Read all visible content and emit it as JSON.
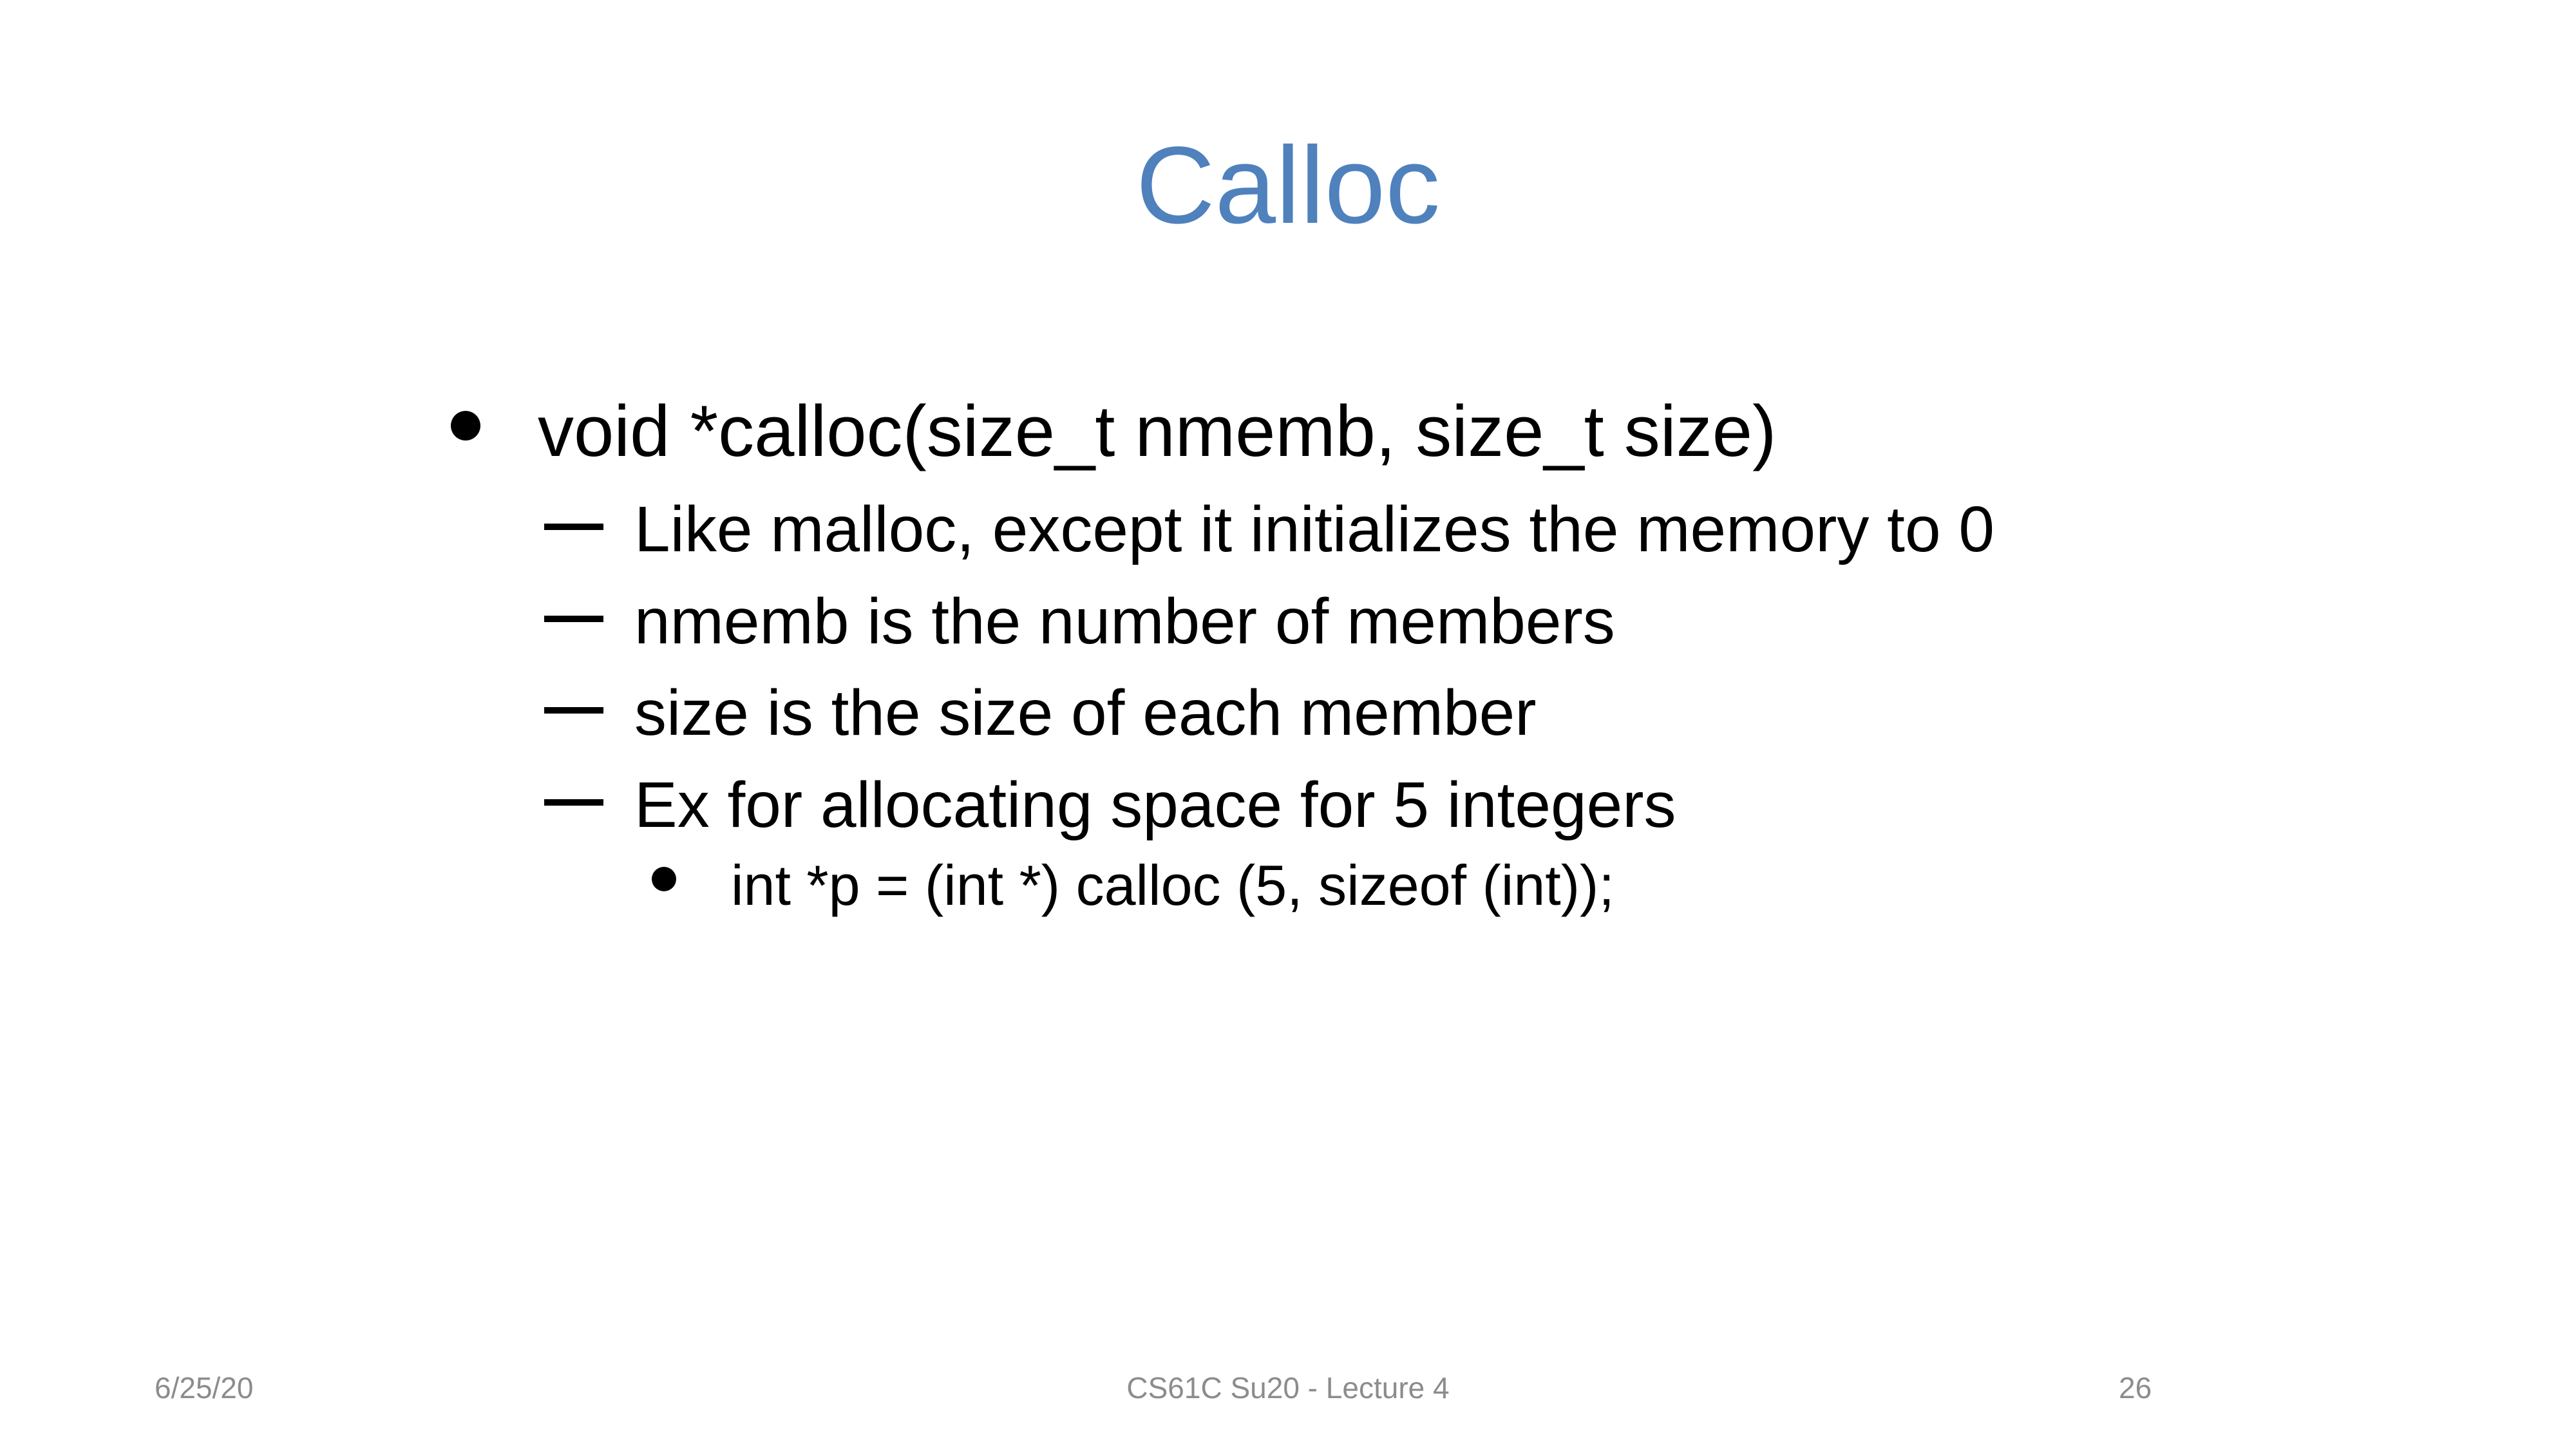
{
  "slide": {
    "title": "Calloc",
    "bullets": [
      {
        "text": "void *calloc(size_t nmemb, size_t size)",
        "sub": [
          {
            "text": "Like malloc, except it initializes the memory to 0"
          },
          {
            "text": "nmemb is the number of members"
          },
          {
            "text": "size is the size of each member"
          },
          {
            "text": "Ex for allocating space for 5 integers",
            "sub": [
              {
                "text": "int *p = (int *) calloc (5, sizeof (int));"
              }
            ]
          }
        ]
      }
    ]
  },
  "footer": {
    "date": "6/25/20",
    "course": "CS61C Su20 - Lecture 4",
    "page": "26"
  },
  "colors": {
    "title": "#4f81bd",
    "footer": "#8c8c8c"
  }
}
